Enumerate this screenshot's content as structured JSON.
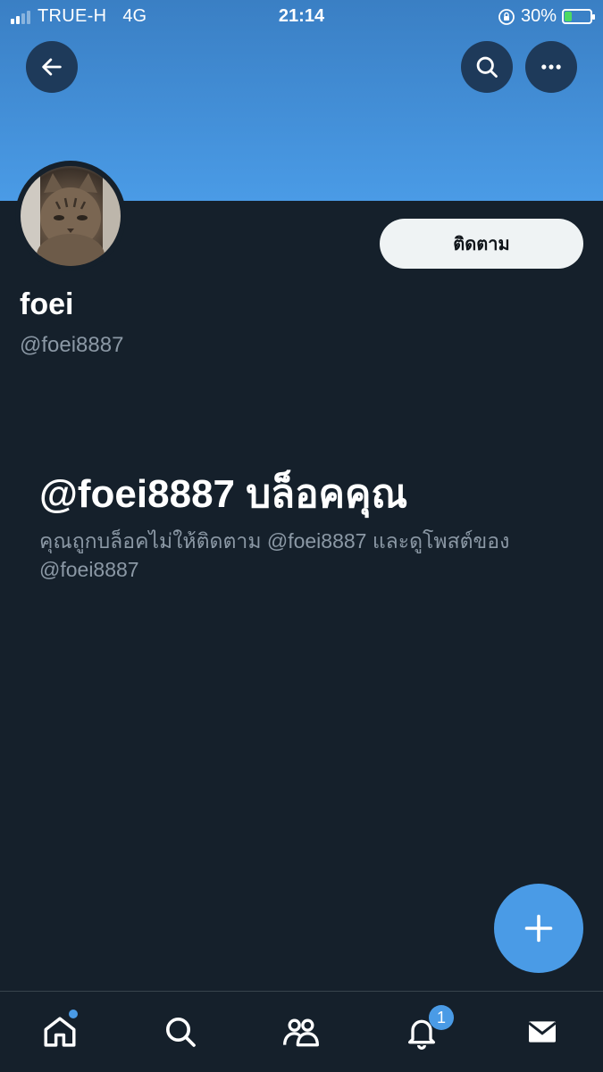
{
  "status_bar": {
    "carrier": "TRUE-H",
    "network": "4G",
    "time": "21:14",
    "battery_percent": "30%"
  },
  "header": {
    "back_icon": "arrow-left-icon",
    "search_icon": "search-icon",
    "more_icon": "more-horizontal-icon"
  },
  "profile": {
    "display_name": "foei",
    "handle": "@foei8887",
    "follow_label": "ติดตาม"
  },
  "blocked": {
    "title": "@foei8887 บล็อคคุณ",
    "description": "คุณถูกบล็อคไม่ให้ติดตาม @foei8887 และดูโพสต์ของ @foei8887"
  },
  "fab": {
    "icon": "plus-icon"
  },
  "tabbar": {
    "items": [
      {
        "icon": "home-icon",
        "has_dot": true
      },
      {
        "icon": "search-icon"
      },
      {
        "icon": "communities-icon"
      },
      {
        "icon": "bell-icon",
        "badge": "1"
      },
      {
        "icon": "mail-icon"
      }
    ]
  },
  "colors": {
    "background": "#15202b",
    "accent": "#4a9be6",
    "muted_text": "#8b98a5",
    "follow_bg": "#eff3f4"
  }
}
